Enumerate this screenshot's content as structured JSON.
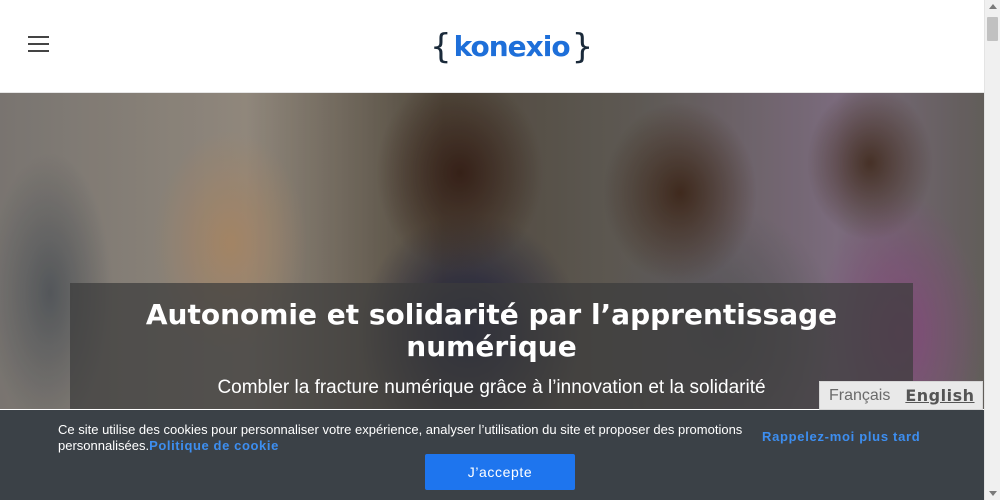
{
  "header": {
    "menu_icon": "hamburger-menu-icon",
    "logo": {
      "brace_open": "{",
      "word": "konexio",
      "brace_close": "}"
    }
  },
  "hero": {
    "title": "Autonomie et solidarité par l’apprentissage numérique",
    "subtitle": "Combler la fracture numérique grâce à l’innovation et la solidarité"
  },
  "language_switcher": {
    "french_label": "Français",
    "english_label": "English"
  },
  "cookie_banner": {
    "text": "Ce site utilise des cookies pour personnaliser votre expérience, analyser l’utilisation du site et proposer des promotions personnalisées.",
    "policy_link": "Politique de cookie",
    "remind_later": "Rappelez-moi plus tard",
    "accept_label": "J’accepte"
  },
  "colors": {
    "brand_blue": "#1e6fd9",
    "accept_button": "#1e75ee",
    "link_blue": "#3d8ef0",
    "banner_bg": "#3b4147"
  }
}
